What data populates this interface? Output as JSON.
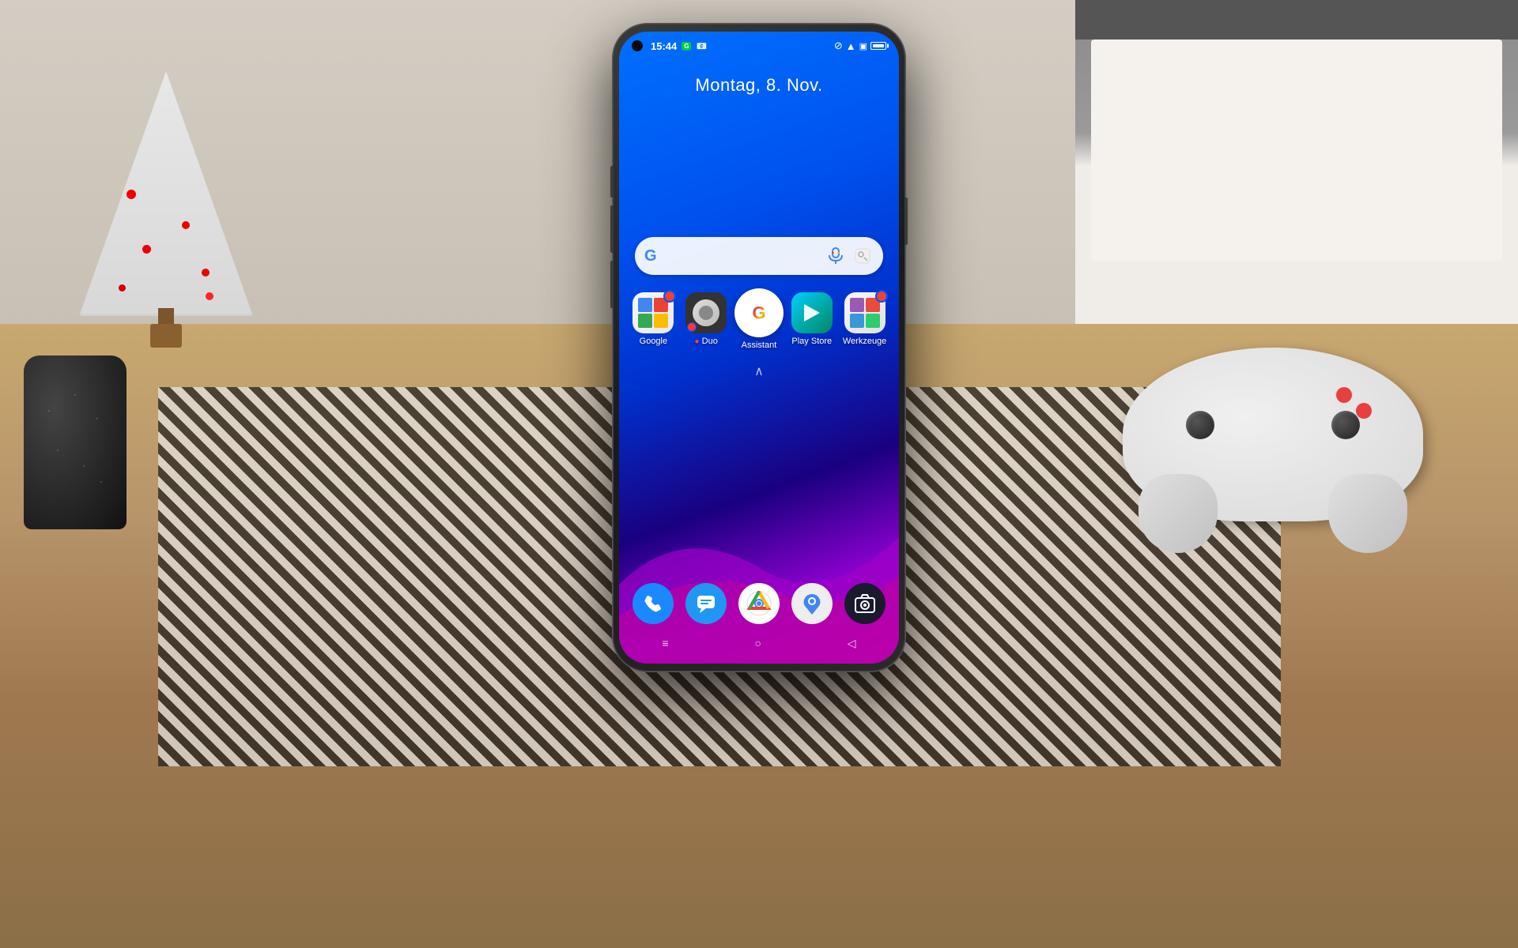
{
  "scene": {
    "background_color": "#8B6F47"
  },
  "phone": {
    "status_bar": {
      "time": "15:44",
      "badge": "G",
      "signal_icon": "N",
      "wifi_icon": "wifi",
      "sim_icon": "sim",
      "battery_icon": "battery"
    },
    "date": "Montag, 8. Nov.",
    "search": {
      "placeholder": "",
      "mic_label": "microphone",
      "lens_label": "lens"
    },
    "apps": [
      {
        "id": "google",
        "label": "Google",
        "icon_type": "google"
      },
      {
        "id": "duo",
        "label": "● Duo",
        "icon_type": "duo"
      },
      {
        "id": "assistant",
        "label": "Assistant",
        "icon_type": "assistant"
      },
      {
        "id": "play-store",
        "label": "Play Store",
        "icon_type": "playstore"
      },
      {
        "id": "werkzeuge",
        "label": "Werkzeuge",
        "icon_type": "werkzeuge"
      }
    ],
    "dock": [
      {
        "id": "phone",
        "label": "Phone",
        "icon": "phone"
      },
      {
        "id": "messages",
        "label": "Messages",
        "icon": "messages"
      },
      {
        "id": "chrome",
        "label": "Chrome",
        "icon": "chrome"
      },
      {
        "id": "maps",
        "label": "Maps",
        "icon": "maps"
      },
      {
        "id": "camera",
        "label": "Camera",
        "icon": "camera"
      }
    ],
    "nav": [
      {
        "id": "menu",
        "symbol": "≡"
      },
      {
        "id": "home",
        "symbol": "○"
      },
      {
        "id": "back",
        "symbol": "◁"
      }
    ]
  }
}
